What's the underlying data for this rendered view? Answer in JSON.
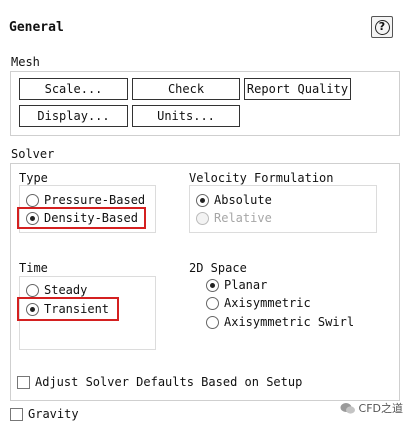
{
  "header": {
    "title": "General",
    "help_icon_glyph": "?"
  },
  "mesh": {
    "label": "Mesh",
    "buttons": {
      "scale": "Scale...",
      "check": "Check",
      "report_quality": "Report Quality",
      "display": "Display...",
      "units": "Units..."
    }
  },
  "solver": {
    "label": "Solver",
    "type": {
      "label": "Type",
      "options": [
        "Pressure-Based",
        "Density-Based"
      ],
      "selected": "Density-Based"
    },
    "velocity": {
      "label": "Velocity Formulation",
      "options": [
        "Absolute",
        "Relative"
      ],
      "selected": "Absolute",
      "disabled": [
        "Relative"
      ]
    },
    "time": {
      "label": "Time",
      "options": [
        "Steady",
        "Transient"
      ],
      "selected": "Transient"
    },
    "space": {
      "label": "2D Space",
      "options": [
        "Planar",
        "Axisymmetric",
        "Axisymmetric Swirl"
      ],
      "selected": "Planar"
    }
  },
  "adjust_defaults": {
    "label": "Adjust Solver Defaults Based on Setup",
    "checked": false
  },
  "gravity": {
    "label": "Gravity",
    "checked": false
  },
  "watermark": {
    "text": "CFD之道"
  },
  "colors": {
    "highlight": "#d42020",
    "border": "#cfcfcf",
    "disabled_text": "#a6a6a6"
  }
}
